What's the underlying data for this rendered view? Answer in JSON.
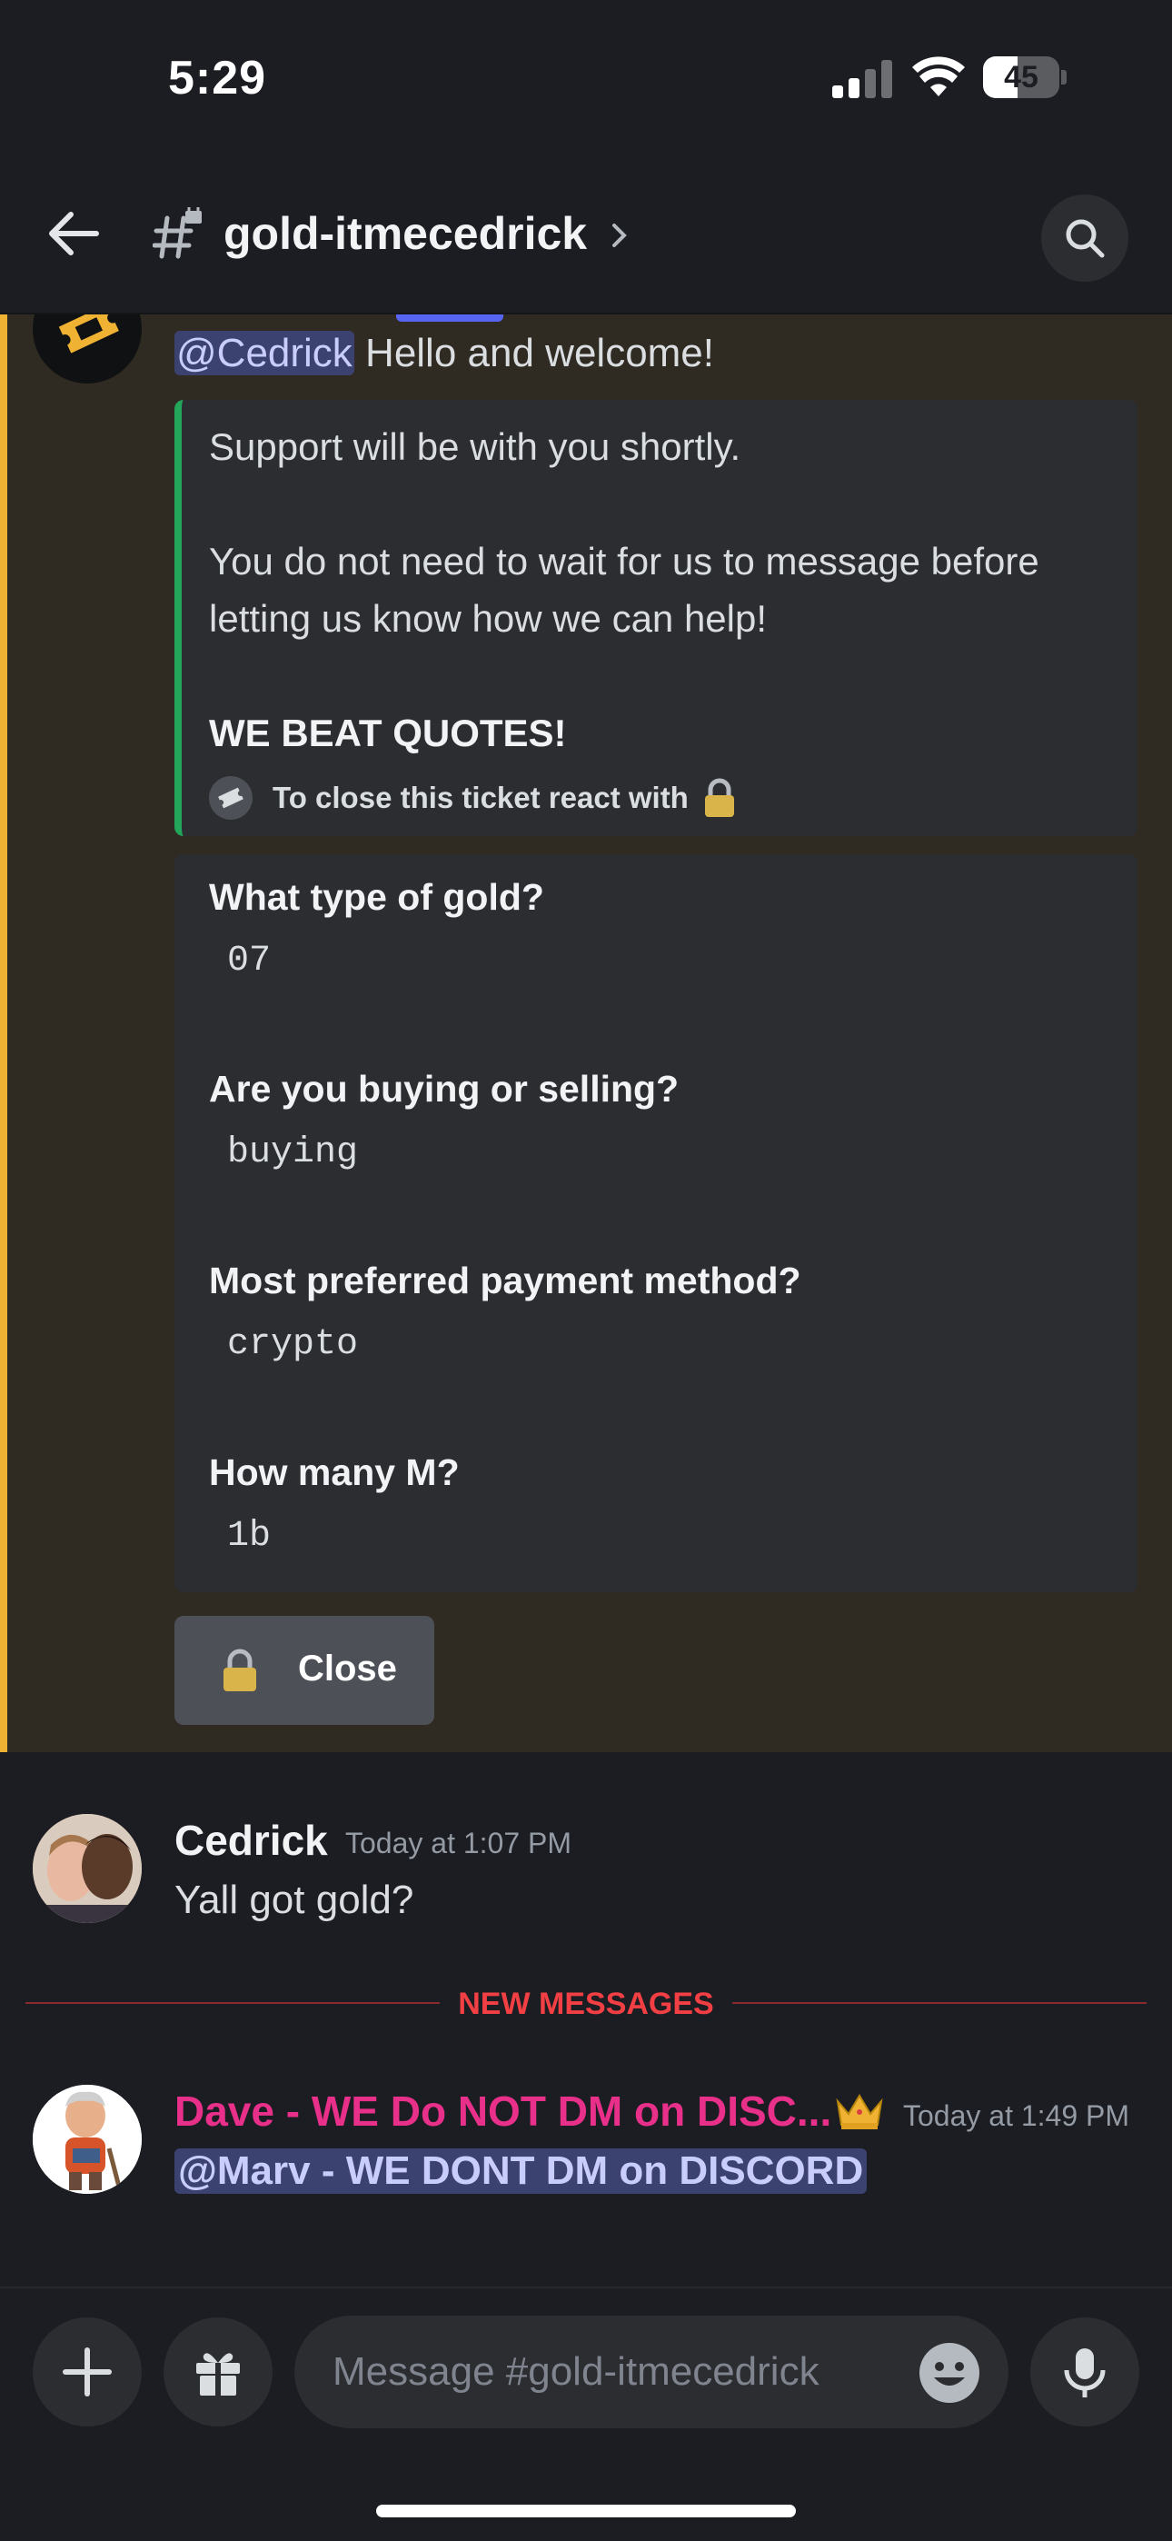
{
  "status_bar": {
    "time": "5:29",
    "battery": "45",
    "battery_level": 0.45
  },
  "header": {
    "channel_name": "gold-itmecedrick",
    "chevron": "›"
  },
  "bot_message": {
    "mention": "@Cedrick",
    "text": " Hello and welcome!",
    "embed": {
      "line1": "Support will be with you shortly.",
      "line2": "You do not need to wait for us to message before letting us know how we can help!",
      "line3": "WE BEAT QUOTES!",
      "footer": "To close this ticket react with"
    },
    "fields": [
      {
        "name": "What type of gold?",
        "value": "07"
      },
      {
        "name": "Are you buying or selling?",
        "value": "buying"
      },
      {
        "name": "Most preferred payment method?",
        "value": "crypto"
      },
      {
        "name": "How many M?",
        "value": "1b"
      }
    ],
    "close_button": "Close"
  },
  "cedrick_message": {
    "author": "Cedrick",
    "time": "Today at 1:07 PM",
    "text": "Yall got gold?"
  },
  "divider": {
    "label": "NEW MESSAGES"
  },
  "dave_message": {
    "author": "Dave - WE Do NOT DM on DISC...",
    "time": "Today at 1:49 PM",
    "mention": "@Marv - WE DONT DM on DISCORD",
    "author_color": "#e8308a"
  },
  "composer": {
    "placeholder": "Message #gold-itmecedrick"
  },
  "colors": {
    "accent_highlight": "#f0b232",
    "embed_bar": "#23a55a",
    "mention_bg": "#3c4270",
    "new_messages": "#f23f43"
  },
  "icons": [
    "back-arrow-icon",
    "hash-lock-icon",
    "search-icon",
    "ticket-icon",
    "lock-icon",
    "crown-icon",
    "plus-icon",
    "gift-icon",
    "emoji-icon",
    "microphone-icon"
  ]
}
